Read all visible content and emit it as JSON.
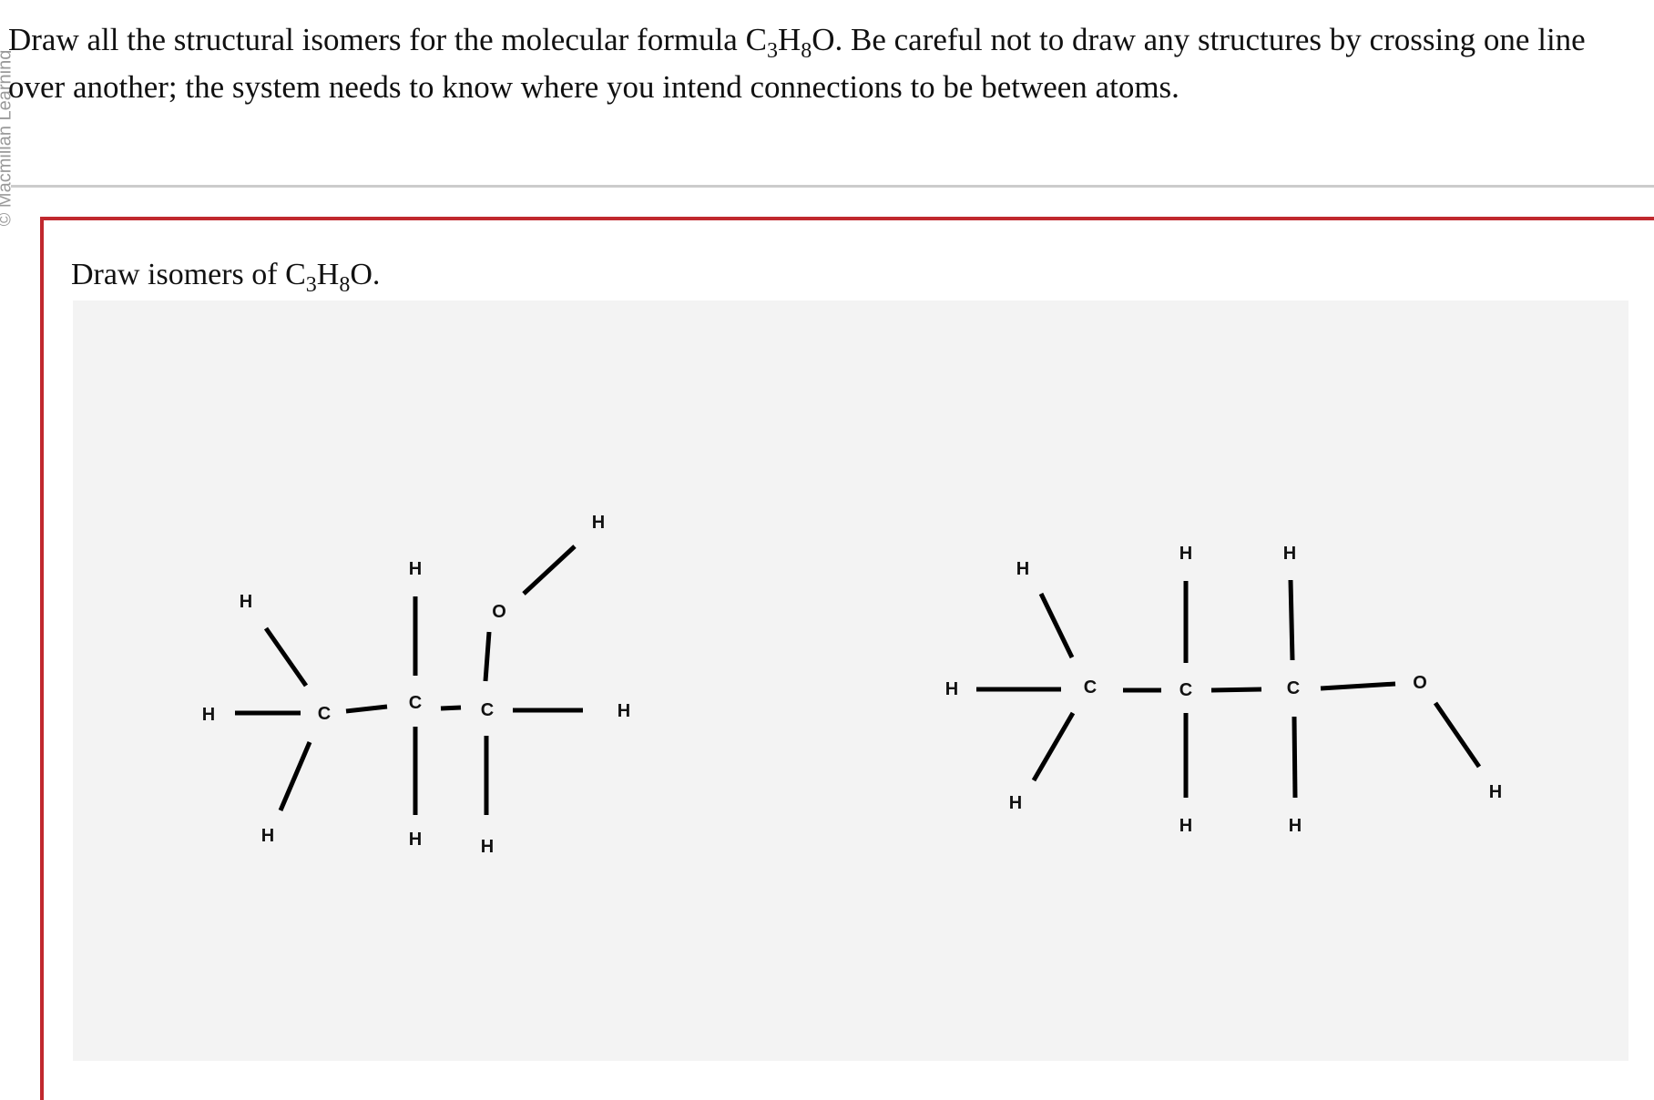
{
  "watermark": "© Macmillan Learning",
  "prompt": {
    "line_start": "Draw all the structural isomers for the molecular formula C",
    "sub1": "3",
    "mid1": "H",
    "sub2": "8",
    "line_end": "O. Be careful not to draw any structures by crossing one line over another; the system needs to know where you intend connections to be between atoms."
  },
  "question": {
    "title_start": "Draw isomers of C",
    "sub1": "3",
    "mid1": "H",
    "sub2": "8",
    "title_end": "O."
  },
  "molecules": [
    {
      "name": "isomer-left",
      "atoms": [
        {
          "id": "H1",
          "label": "H"
        },
        {
          "id": "H2",
          "label": "H"
        },
        {
          "id": "C1",
          "label": "C"
        },
        {
          "id": "H3",
          "label": "H"
        },
        {
          "id": "H4",
          "label": "H"
        },
        {
          "id": "C2",
          "label": "C"
        },
        {
          "id": "H5",
          "label": "H"
        },
        {
          "id": "C3",
          "label": "C"
        },
        {
          "id": "H6",
          "label": "H"
        },
        {
          "id": "H7",
          "label": "H"
        },
        {
          "id": "O1",
          "label": "O"
        },
        {
          "id": "H8",
          "label": "H"
        }
      ]
    },
    {
      "name": "isomer-right",
      "atoms": [
        {
          "id": "H1",
          "label": "H"
        },
        {
          "id": "H2",
          "label": "H"
        },
        {
          "id": "C1",
          "label": "C"
        },
        {
          "id": "H3",
          "label": "H"
        },
        {
          "id": "C2",
          "label": "C"
        },
        {
          "id": "H4",
          "label": "H"
        },
        {
          "id": "H5",
          "label": "H"
        },
        {
          "id": "C3",
          "label": "C"
        },
        {
          "id": "H6",
          "label": "H"
        },
        {
          "id": "H7",
          "label": "H"
        },
        {
          "id": "O1",
          "label": "O"
        },
        {
          "id": "H8",
          "label": "H"
        }
      ]
    }
  ]
}
